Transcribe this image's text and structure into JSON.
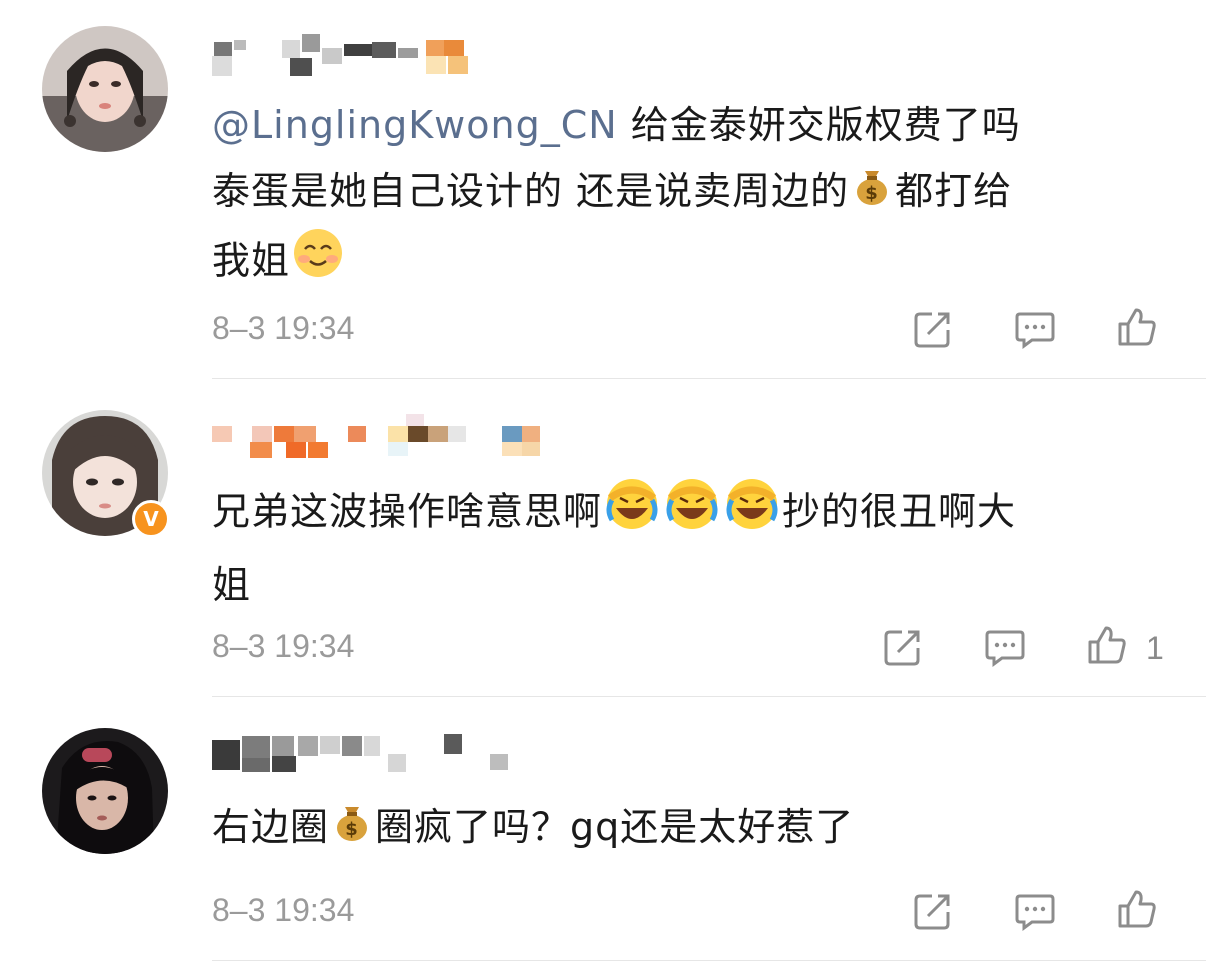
{
  "comments": [
    {
      "username": "",
      "text_mention": "@LinglingKwong_CN",
      "text_parts": [
        "给金泰妍交版权费了吗",
        "泰蛋是她自己设计的 还是说卖周边的",
        "都打给",
        "我姐"
      ],
      "emojis": [
        "money-bag",
        "smile"
      ],
      "time": "8–3 19:34",
      "like_count": ""
    },
    {
      "username": "",
      "verified": true,
      "verified_mark": "V",
      "text_parts": [
        "兄弟这波操作啥意思啊",
        "抄的很丑啊大",
        "姐"
      ],
      "emojis": [
        "laugh-cry",
        "laugh-cry",
        "laugh-cry"
      ],
      "time": "8–3 19:34",
      "like_count": "1"
    },
    {
      "username": "",
      "text_parts": [
        "右边圈",
        "圈疯了吗？gq还是太好惹了"
      ],
      "emojis": [
        "money-bag"
      ],
      "time": "8–3 19:34",
      "like_count": ""
    }
  ],
  "icons": {
    "share": "share-icon",
    "comment": "comment-icon",
    "like": "thumbs-up-icon"
  },
  "colors": {
    "mention": "#5b6f8f",
    "verified_badge": "#f7931e",
    "meta_text": "#9a9a9a"
  }
}
